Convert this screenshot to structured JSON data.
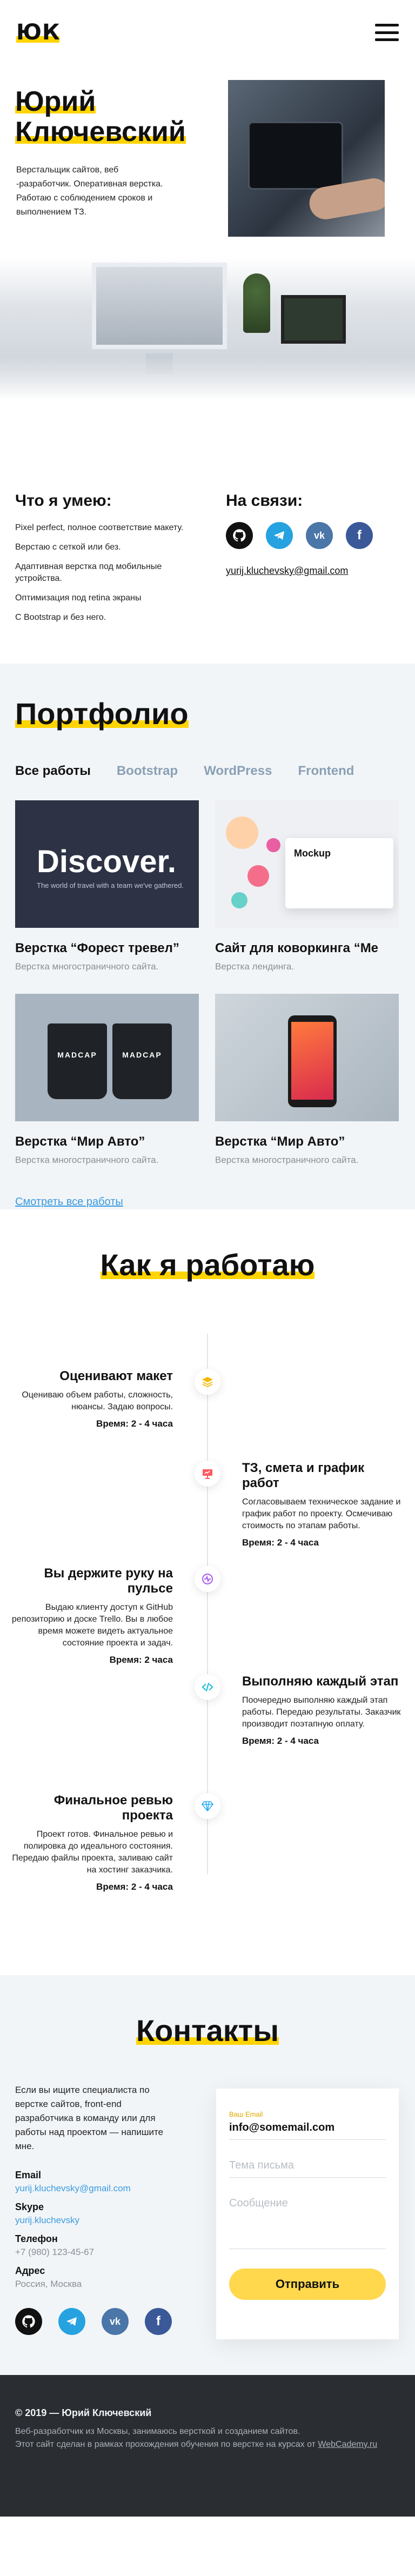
{
  "header": {
    "logo": "ЮК"
  },
  "hero": {
    "name_line1": "Юрий",
    "name_line2": "Ключевский",
    "description": "Верстальщик сайтов, веб -разработчик. Оперативная верстка. Работаю с соблюдением сроков и выполнением ТЗ."
  },
  "skills": {
    "title": "Что я умею:",
    "items": [
      "Pixel perfect, полное соответствие макету.",
      "Верстаю с сеткой или без.",
      "Адаптивная верстка под мобильные устройства.",
      "Оптимизация под retina экраны",
      "С Bootstrap и без него."
    ]
  },
  "social": {
    "title": "На связи:",
    "email": "yurij.kluchevsky@gmail.com",
    "icons": [
      "github-icon",
      "telegram-icon",
      "vk-icon",
      "facebook-icon"
    ]
  },
  "portfolio": {
    "title": "Портфолио",
    "tabs": [
      "Все работы",
      "Bootstrap",
      "WordPress",
      "Frontend"
    ],
    "cards": [
      {
        "title": "Верстка “Форест тревел”",
        "subtitle": "Верстка многостраничного сайта.",
        "img_text": "Discover."
      },
      {
        "title": "Сайт для коворкинга “Ме",
        "subtitle": "Верстка лендинга.",
        "img_text": "Mockup"
      },
      {
        "title": "Верстка “Мир Авто”",
        "subtitle": "Верстка многостраничного сайта.",
        "img_text": "MADCAP"
      },
      {
        "title": "Верстка “Мир Авто”",
        "subtitle": "Верстка многостраничного сайта.",
        "img_text": ""
      }
    ],
    "all_link": "Смотреть все работы"
  },
  "work": {
    "title": "Как я работаю",
    "steps": [
      {
        "title": "Оценивают макет",
        "text": "Оцениваю объем работы, сложность, нюансы. Задаю вопросы.",
        "time": "Время: 2 - 4 часа"
      },
      {
        "title": "ТЗ, смета и график работ",
        "text": "Согласовываем техническое задание и график работ по проекту. Осмечиваю стоимость по этапам работы.",
        "time": "Время: 2 - 4 часа"
      },
      {
        "title": "Вы держите руку на пульсе",
        "text": "Выдаю клиенту доступ к GitHub репозиторию и доске Trello. Вы в любое время можете видеть актуальное состояние проекта и задач.",
        "time": "Время: 2 часа"
      },
      {
        "title": "Выполняю каждый этап",
        "text": "Поочередно выполняю каждый этап работы. Передаю результаты. Заказчик производит поэтапную оплату.",
        "time": "Время: 2 - 4 часа"
      },
      {
        "title": "Финальное ревью проекта",
        "text": "Проект готов. Финальное ревью и полировка до идеального состояния. Передаю файлы проекта, заливаю сайт на хостинг заказчика.",
        "time": "Время: 2 - 4 часа"
      }
    ]
  },
  "contacts": {
    "title": "Контакты",
    "intro": "Если вы ищите специалиста по верстке сайтов, front-end разработчика в команду или для работы над проектом — напишите мне.",
    "email_label": "Email",
    "email": "yurij.kluchevsky@gmail.com",
    "skype_label": "Skype",
    "skype": "yurij.kluchevsky",
    "phone_label": "Телефон",
    "phone": "+7 (980) 123-45-67",
    "address_label": "Адрес",
    "address": "Россия, Москва",
    "form": {
      "email_label": "Ваш Email",
      "email_value": "info@somemail.com",
      "subject_placeholder": "Тема письма",
      "message_placeholder": "Сообщение",
      "submit": "Отправить"
    }
  },
  "footer": {
    "copyright": "© 2019 — Юрий Ключевский",
    "line1": "Веб-разработчик из Москвы, занимаюсь версткой и созданием сайтов.",
    "line2_prefix": "Этот сайт сделан в рамках прохождения обучения по верстке на курсах от ",
    "link": "WebCademy.ru"
  },
  "colors": {
    "accent": "#ffd400",
    "link": "#3a9be0",
    "bg_light": "#f2f5f8",
    "footer_bg": "#2a2e33"
  }
}
